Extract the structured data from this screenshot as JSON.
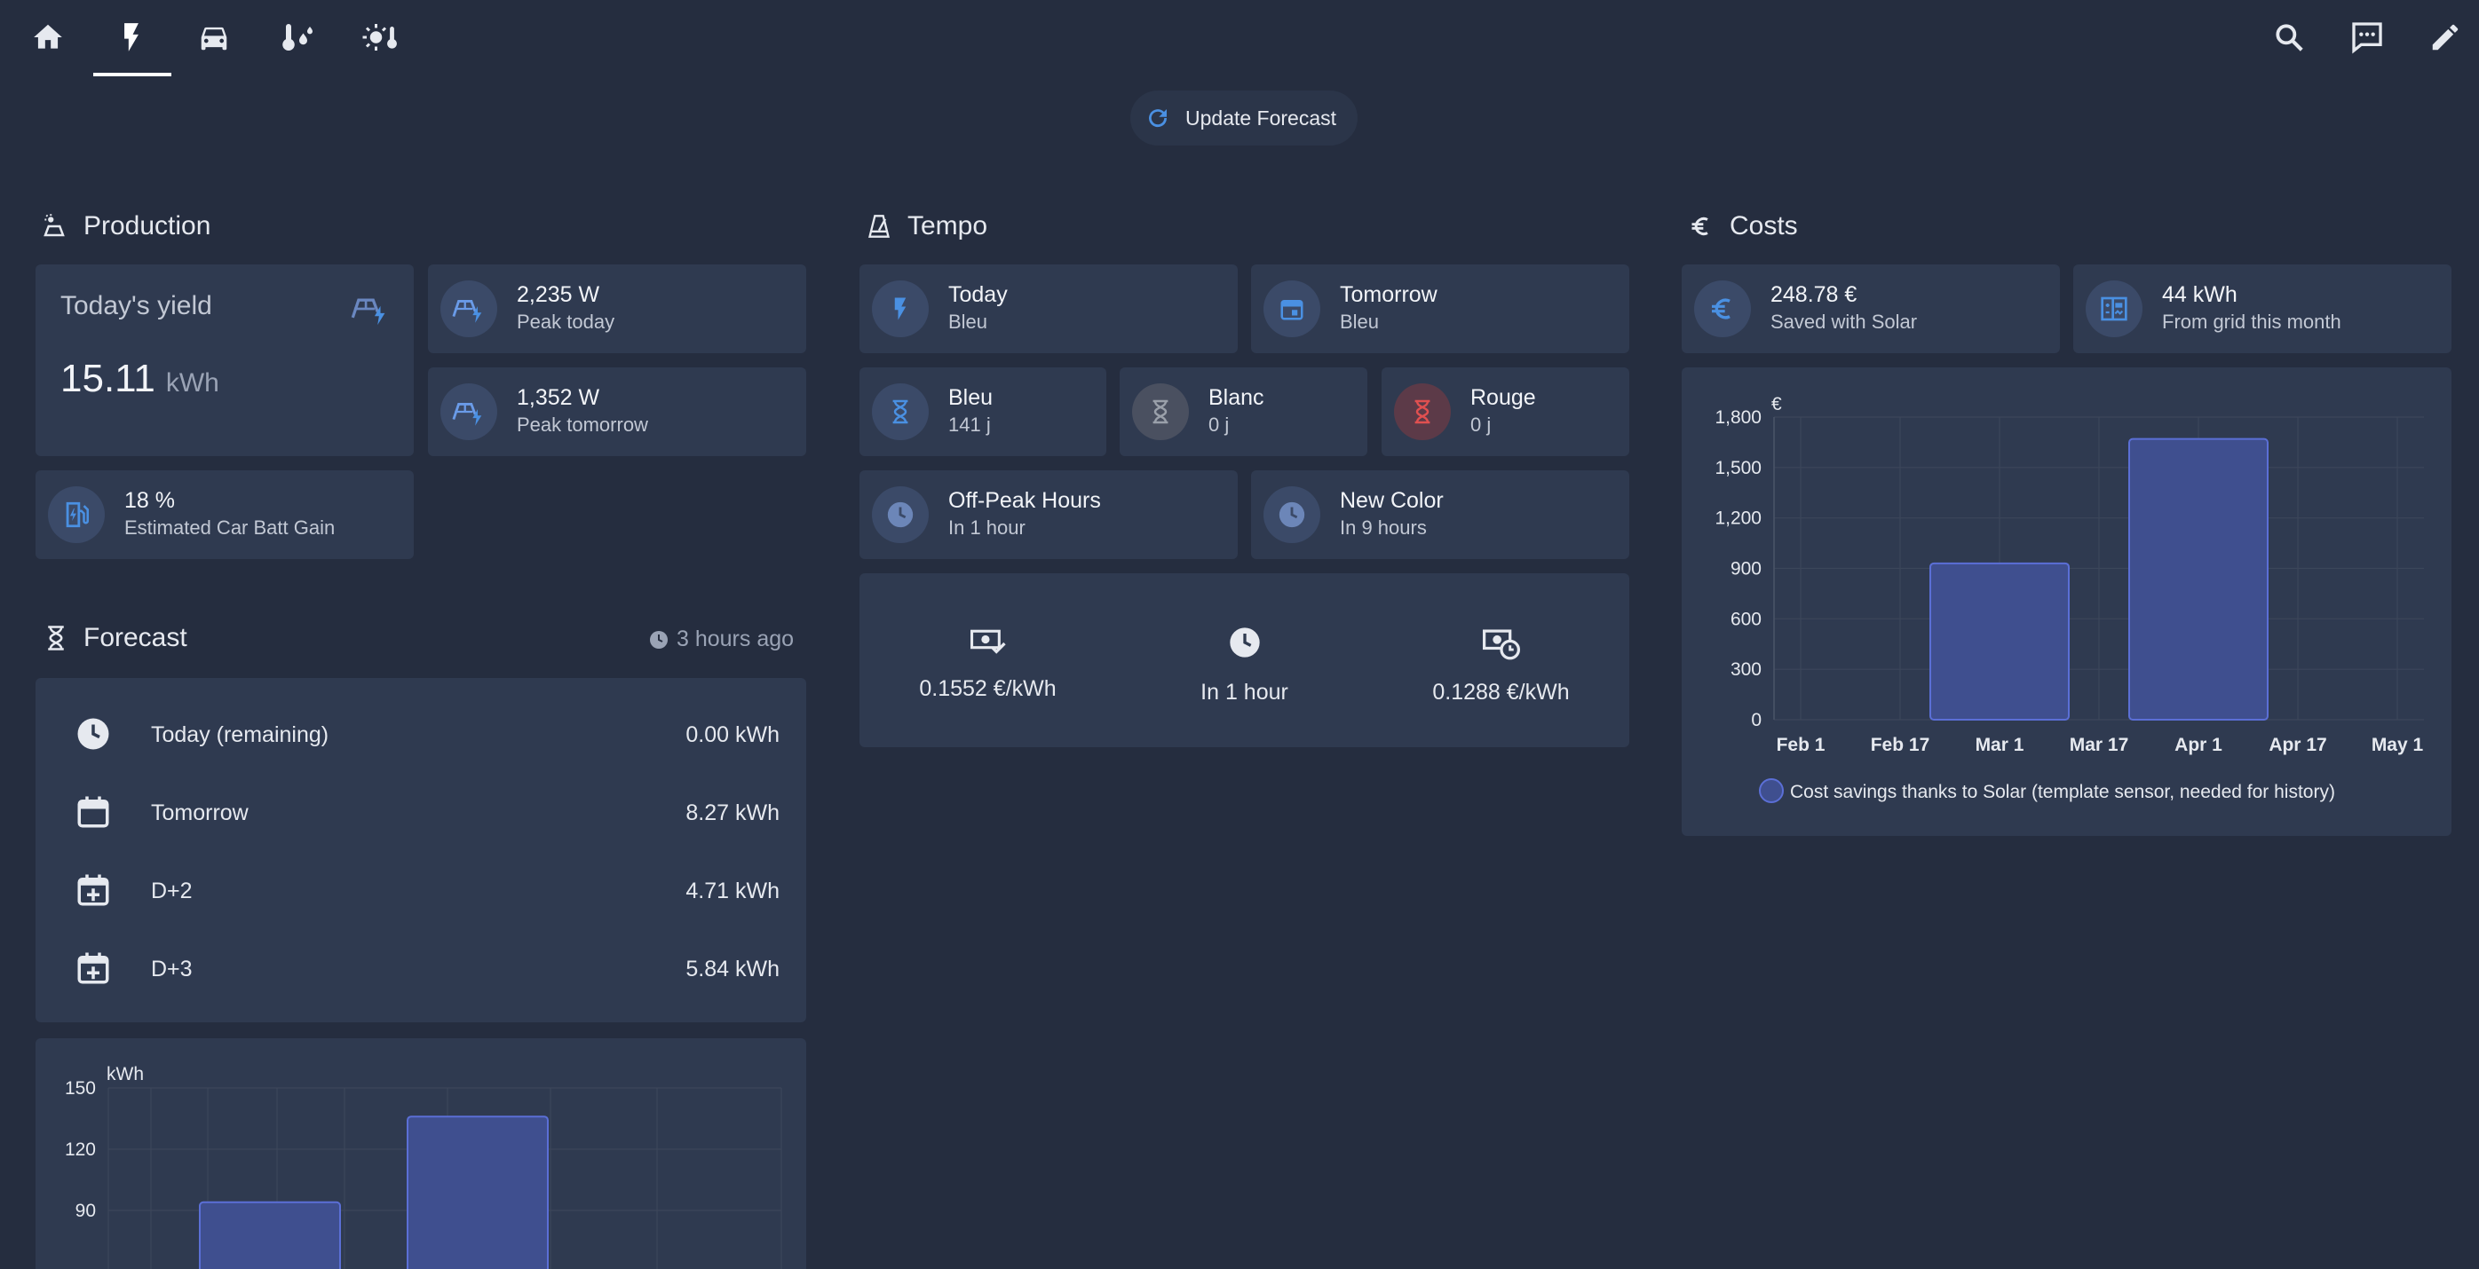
{
  "topbar": {
    "update_button": "Update Forecast"
  },
  "production": {
    "title": "Production",
    "yield_title": "Today's yield",
    "yield_value": "15.11",
    "yield_unit": "kWh",
    "peak_today_value": "2,235 W",
    "peak_today_label": "Peak today",
    "peak_tomorrow_value": "1,352 W",
    "peak_tomorrow_label": "Peak tomorrow",
    "car_value": "18 %",
    "car_label": "Estimated Car Batt Gain"
  },
  "forecast": {
    "title": "Forecast",
    "updated": "3 hours ago",
    "rows": [
      {
        "label": "Today (remaining)",
        "value": "0.00 kWh"
      },
      {
        "label": "Tomorrow",
        "value": "8.27 kWh"
      },
      {
        "label": "D+2",
        "value": "4.71 kWh"
      },
      {
        "label": "D+3",
        "value": "5.84 kWh"
      }
    ]
  },
  "tempo": {
    "title": "Tempo",
    "today_title": "Today",
    "today_value": "Bleu",
    "tomorrow_title": "Tomorrow",
    "tomorrow_value": "Bleu",
    "bleu_title": "Bleu",
    "bleu_value": "141 j",
    "blanc_title": "Blanc",
    "blanc_value": "0 j",
    "rouge_title": "Rouge",
    "rouge_value": "0 j",
    "offpeak_title": "Off-Peak Hours",
    "offpeak_value": "In 1 hour",
    "newcolor_title": "New Color",
    "newcolor_value": "In 9 hours",
    "price_now": "0.1552 €/kWh",
    "next_change": "In 1 hour",
    "price_next": "0.1288 €/kWh"
  },
  "costs": {
    "title": "Costs",
    "saved_value": "248.78 €",
    "saved_label": "Saved with Solar",
    "grid_value": "44 kWh",
    "grid_label": "From grid this month"
  },
  "colors": {
    "background": "#252d3f",
    "card": "#2f3a50",
    "accent": "#4a90e2",
    "bar_fill": "#3f4f8f",
    "bar_stroke": "#5b6fd6",
    "rouge": "#e05050"
  },
  "chart_data": [
    {
      "type": "bar",
      "unit_label": "€",
      "ylim": [
        0,
        1800
      ],
      "yticks": [
        0,
        300,
        600,
        900,
        1200,
        1500,
        1800
      ],
      "ytick_labels": [
        "0",
        "300",
        "600",
        "900",
        "1,200",
        "1,500",
        "1,800"
      ],
      "xtick_labels": [
        "Feb 1",
        "Feb 17",
        "Mar 1",
        "Mar 17",
        "Apr 1",
        "Apr 17",
        "May 1"
      ],
      "categories": [
        "Mar 1",
        "Apr 1"
      ],
      "series": [
        {
          "name": "Cost savings thanks to Solar (template sensor, needed for history)",
          "values": [
            930,
            1670
          ]
        }
      ],
      "grid": true,
      "legend": "bottom"
    },
    {
      "type": "bar",
      "unit_label": "kWh",
      "ylim_visible": [
        90,
        150
      ],
      "yticks_visible": [
        90,
        120,
        150
      ],
      "ytick_labels": [
        "150",
        "120",
        "90"
      ],
      "values_visible_tops": [
        94,
        136
      ],
      "grid": true
    }
  ]
}
